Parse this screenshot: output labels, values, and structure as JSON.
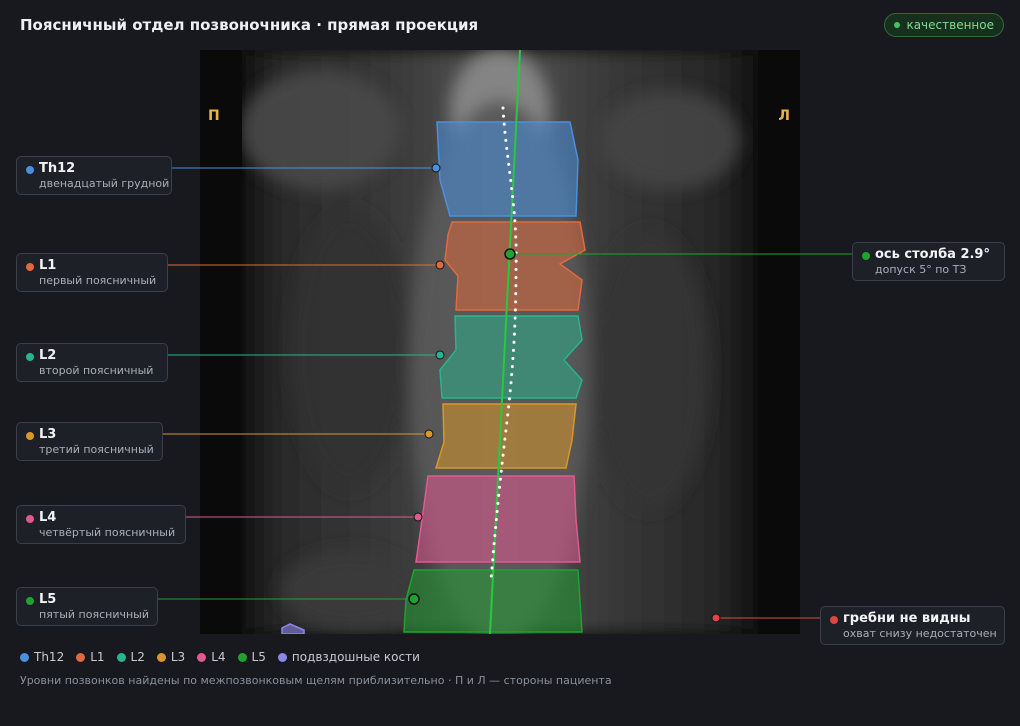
{
  "header": {
    "title": "Поясничный отдел позвоночника · прямая проекция",
    "badge": "качественное",
    "badge_color": "#47c35e"
  },
  "image": {
    "side_right": "П",
    "side_left": "Л"
  },
  "labels": [
    {
      "name": "Th12",
      "desc": "двенадцатый грудной",
      "color": "#4a8fe0"
    },
    {
      "name": "L1",
      "desc": "первый поясничный",
      "color": "#e06a3e"
    },
    {
      "name": "L2",
      "desc": "второй поясничный",
      "color": "#27b58f"
    },
    {
      "name": "L3",
      "desc": "третий поясничный",
      "color": "#d9972a"
    },
    {
      "name": "L4",
      "desc": "четвёртый поясничный",
      "color": "#e05a8f"
    },
    {
      "name": "L5",
      "desc": "пятый поясничный",
      "color": "#1ea32e"
    }
  ],
  "axis_card": {
    "name": "ось столба 2.9°",
    "desc": "допуск 5° по ТЗ",
    "color": "#1ea32e"
  },
  "crest_card": {
    "name": "гребни не видны",
    "desc": "охват снизу недостаточен",
    "color": "#e04545"
  },
  "legend": [
    {
      "label": "Th12",
      "color": "#4a8fe0"
    },
    {
      "label": "L1",
      "color": "#e06a3e"
    },
    {
      "label": "L2",
      "color": "#27b58f"
    },
    {
      "label": "L3",
      "color": "#d9972a"
    },
    {
      "label": "L4",
      "color": "#e05a8f"
    },
    {
      "label": "L5",
      "color": "#1ea32e"
    },
    {
      "label": "подвздошные кости",
      "color": "#8b86e8"
    }
  ],
  "footnote": "Уровни позвонков найдены по межпозвонковым щелям приблизительно · П и Л — стороны пациента"
}
